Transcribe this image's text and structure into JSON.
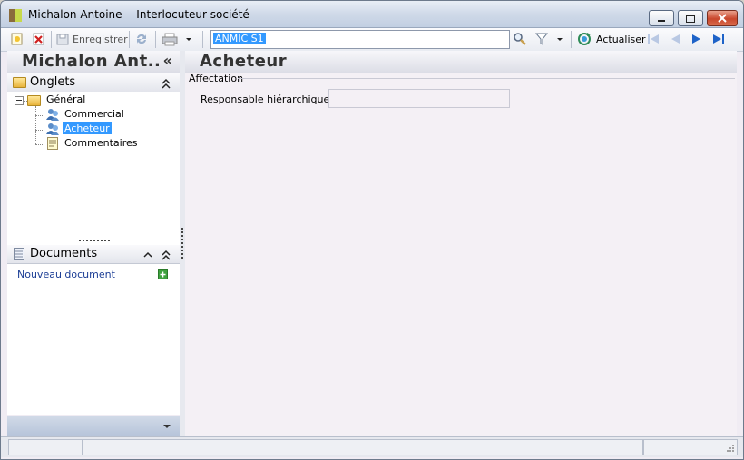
{
  "window": {
    "title": "Michalon Antoine -  Interlocuteur société",
    "app_icon": "app-icon"
  },
  "toolbar": {
    "new_icon": "new-icon",
    "delete_icon": "delete-icon",
    "save_label": "Enregistrer",
    "refresh_icon": "sync-icon",
    "print_icon": "print-icon",
    "search_value": "ANMIC S1",
    "search_icon": "search-icon",
    "filter_icon": "filter-icon",
    "actualiser_label": "Actualiser"
  },
  "left": {
    "header_title": "Michalon Ant..",
    "collapse_glyph": "«",
    "onglets": {
      "title": "Onglets",
      "tree": {
        "root": "Général",
        "children": [
          "Commercial",
          "Acheteur",
          "Commentaires"
        ],
        "selected": "Acheteur"
      }
    },
    "documents": {
      "title": "Documents",
      "new_doc_label": "Nouveau document"
    }
  },
  "main": {
    "title": "Acheteur",
    "group_title": "Affectation",
    "field_label": "Responsable hiérarchique :",
    "field_value": ""
  },
  "colors": {
    "selection": "#3399ff",
    "title_gradient_start": "#e9eef6",
    "accent_blue": "#1e63c8"
  }
}
